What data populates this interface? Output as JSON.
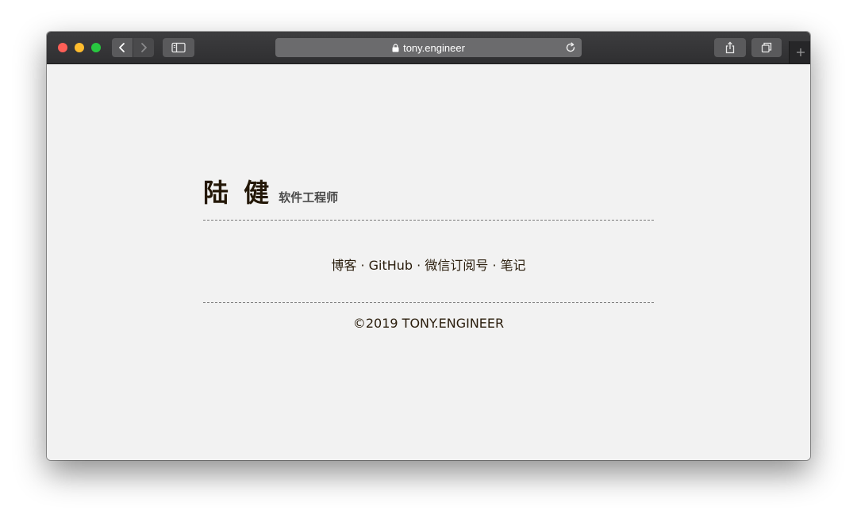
{
  "browser": {
    "url": "tony.engineer",
    "icons": {
      "back": "chevron-left-icon",
      "forward": "chevron-right-icon",
      "sidebar": "sidebar-icon",
      "lock": "lock-icon",
      "reload": "reload-icon",
      "share": "share-icon",
      "tabs": "tabs-overview-icon",
      "new_tab": "plus-icon"
    }
  },
  "page": {
    "name": "陆 健",
    "title": "软件工程师",
    "links": [
      {
        "label": "博客"
      },
      {
        "label": "GitHub"
      },
      {
        "label": "微信订阅号"
      },
      {
        "label": "笔记"
      }
    ],
    "separator": "·",
    "copyright": "©2019 TONY.ENGINEER"
  },
  "colors": {
    "text": "#2a1d0c",
    "background": "#f2f2f2",
    "toolbar": "#333335"
  }
}
